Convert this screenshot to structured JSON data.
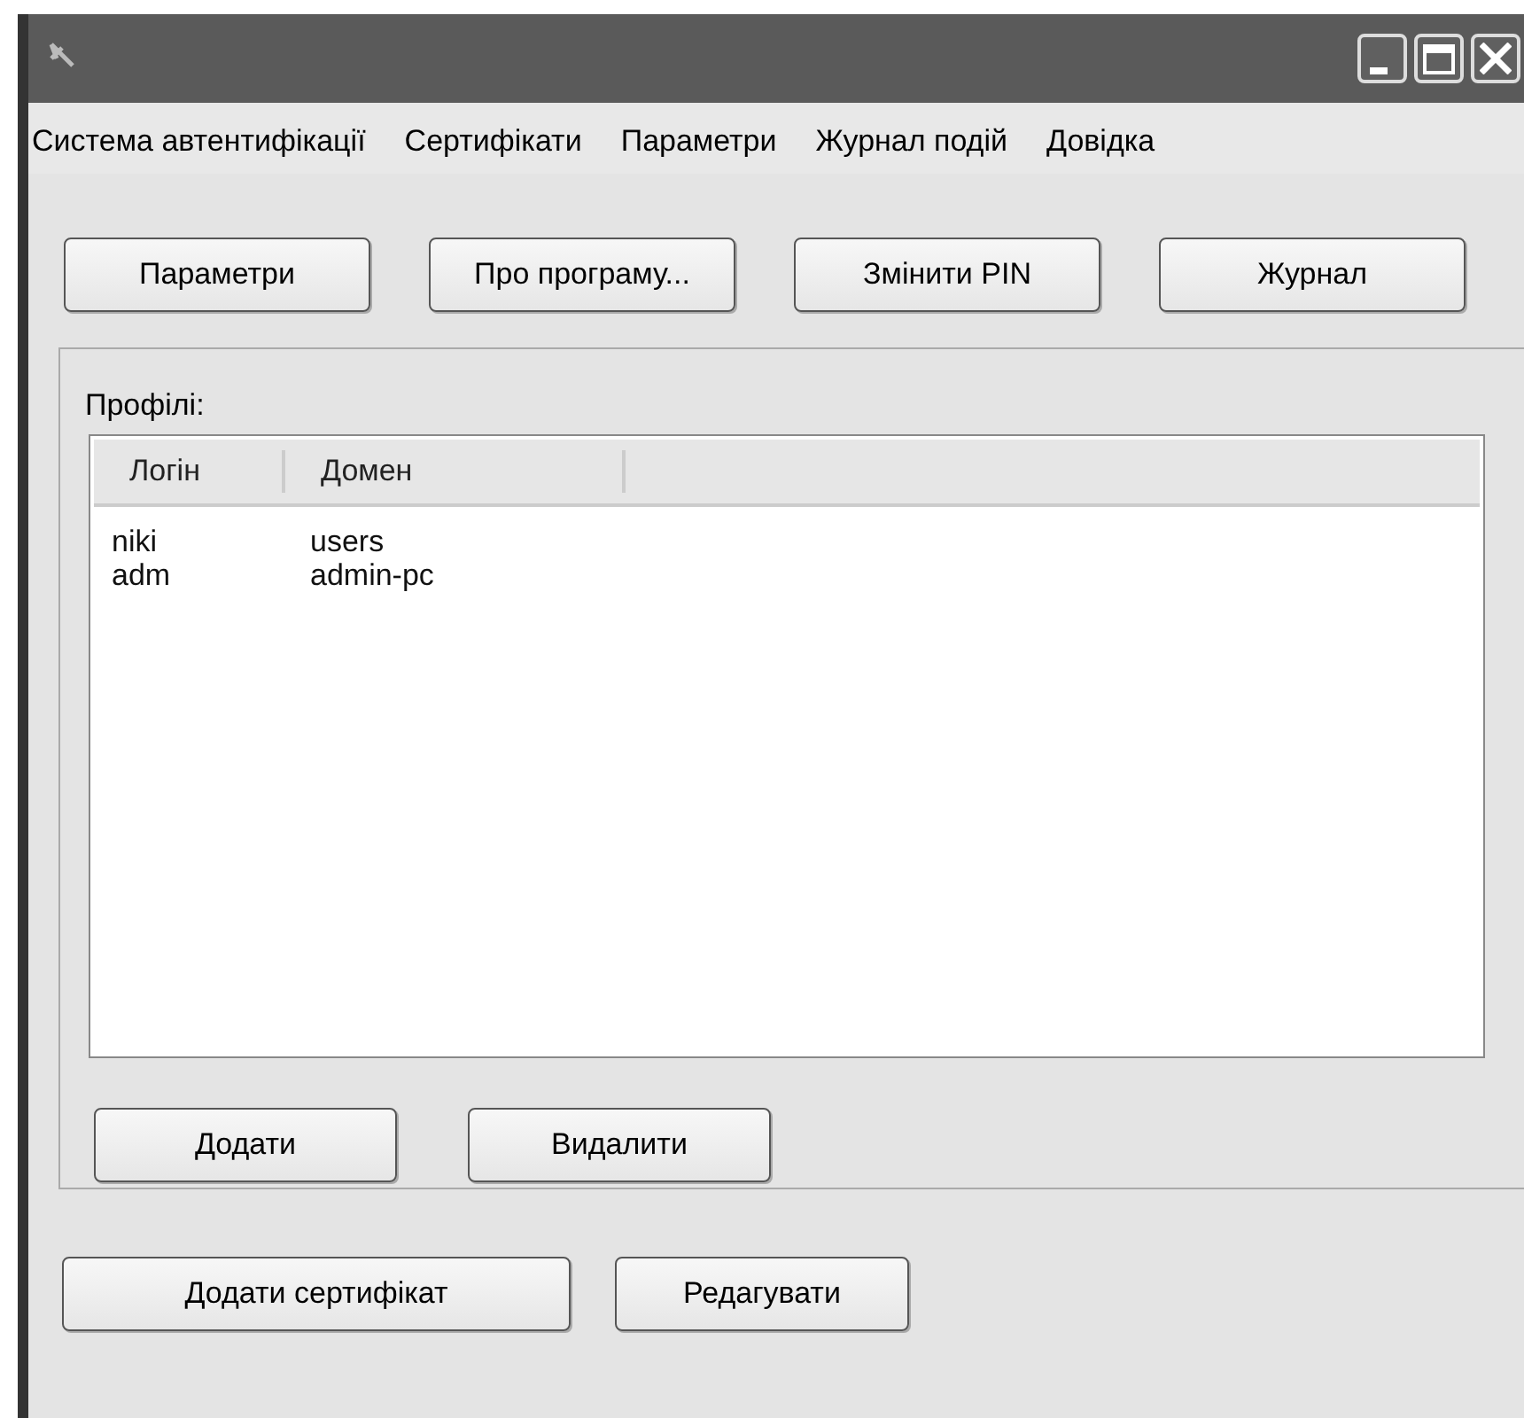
{
  "window": {
    "title_buttons": [
      {
        "kind": "minimize"
      },
      {
        "kind": "maximize"
      },
      {
        "kind": "close"
      }
    ]
  },
  "menu": [
    "Система автентифікації",
    "Сертифікати",
    "Параметри",
    "Журнал подій",
    "Довідка"
  ],
  "toolbar": [
    "Параметри",
    "Про програму...",
    "Змінити PIN",
    "Журнал"
  ],
  "profiles": {
    "label": "Профілі:",
    "columns": [
      "Логін",
      "Домен"
    ],
    "rows": [
      [
        "niki",
        "users"
      ],
      [
        "adm",
        "admin-pc"
      ]
    ],
    "buttons": [
      "Додати",
      "Видалити"
    ]
  },
  "bottom_buttons": [
    "Додати сертифікат",
    "Редагувати"
  ]
}
